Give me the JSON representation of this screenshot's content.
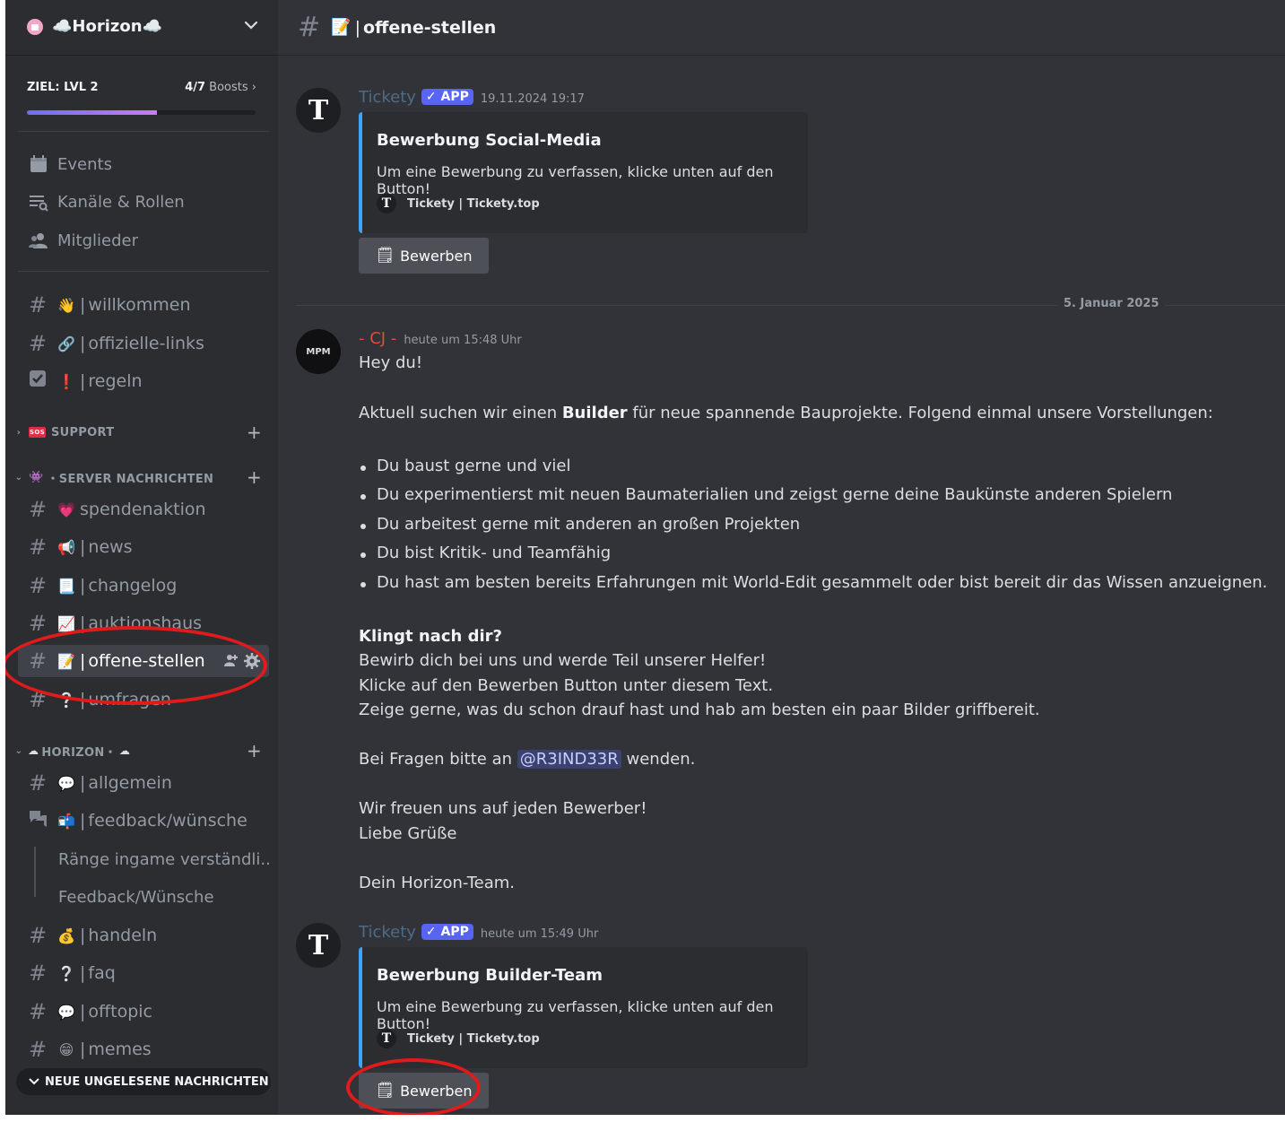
{
  "server": {
    "name": "☁️Horizon☁️",
    "boost_goal": "ZIEL: LVL 2",
    "boost_count_strong": "4/7",
    "boost_count_label": " Boosts",
    "boost_progress": 0.57
  },
  "nav": [
    {
      "label": "Events",
      "icon": "calendar-icon"
    },
    {
      "label": "Kanäle & Rollen",
      "icon": "channel-browse-icon"
    },
    {
      "label": "Mitglieder",
      "icon": "members-icon"
    }
  ],
  "channels_top": [
    {
      "emoji": "👋",
      "name": "willkommen"
    },
    {
      "emoji": "🔗",
      "name": "offizielle-links"
    },
    {
      "emoji": "❗",
      "name": "regeln"
    }
  ],
  "categories": {
    "support": "SUPPORT",
    "server_news": "・SERVER NACHRICHTEN",
    "horizon": "HORIZON・"
  },
  "channels_news": [
    {
      "emoji": "💗",
      "name": "spendenaktion"
    },
    {
      "emoji": "📢",
      "name": "news"
    },
    {
      "emoji": "📃",
      "name": "changelog"
    },
    {
      "emoji": "📈",
      "name": "auktionshaus"
    },
    {
      "emoji": "📝",
      "name": "offene-stellen"
    },
    {
      "emoji": "❔",
      "name": "umfragen"
    }
  ],
  "channels_horizon": [
    {
      "emoji": "💬",
      "name": "allgemein"
    },
    {
      "emoji": "📬",
      "name": "feedback/wünsche"
    }
  ],
  "threads": [
    "Ränge ingame verständli...",
    "Feedback/Wünsche"
  ],
  "channels_horizon2": [
    {
      "emoji": "💰",
      "name": "handeln"
    },
    {
      "emoji": "❔",
      "name": "faq"
    },
    {
      "emoji": "💬",
      "name": "offtopic"
    },
    {
      "emoji": "😁",
      "name": "memes"
    }
  ],
  "unread_pill": "NEUE UNGELESENE NACHRICHTEN",
  "channel_header": {
    "emoji": "📝",
    "name": "offene-stellen"
  },
  "messages": {
    "m1": {
      "author": "Tickety",
      "badge": "✓ APP",
      "timestamp": "19.11.2024 19:17",
      "embed_title": "Bewerbung Social-Media",
      "embed_desc": "Um eine Bewerbung zu verfassen, klicke unten auf den Button!",
      "embed_footer": "Tickety | Tickety.top",
      "button": "Bewerben"
    },
    "date_divider": "5. Januar 2025",
    "m2": {
      "author": "- CJ -",
      "timestamp": "heute um 15:48 Uhr",
      "greeting": "Hey du!",
      "intro_a": "Aktuell suchen wir einen ",
      "intro_bold": "Builder",
      "intro_b": " für neue spannende Bauprojekte. Folgend einmal unsere Vorstellungen:",
      "bullets": [
        "Du baust gerne und viel",
        "Du experimentierst mit neuen Baumaterialien und zeigst gerne deine Baukünste anderen Spielern",
        "Du arbeitest gerne mit anderen an großen Projekten",
        "Du bist Kritik- und Teamfähig",
        "Du hast am besten bereits Erfahrungen mit World-Edit gesammelt oder bist bereit dir das Wissen anzueignen."
      ],
      "cta_heading": "Klingt nach dir?",
      "cta_1": "Bewirb dich bei uns und werde Teil unserer Helfer!",
      "cta_2": "Klicke auf den Bewerben Button unter diesem Text.",
      "cta_3": "Zeige gerne, was du schon drauf hast und hab am besten ein paar Bilder griffbereit.",
      "questions_a": "Bei Fragen bitte an ",
      "mention": "@R3IND33R",
      "questions_b": " wenden.",
      "closing_1": "Wir freuen uns auf jeden Bewerber!",
      "closing_2": "Liebe Grüße",
      "signature": "Dein Horizon-Team."
    },
    "m3": {
      "author": "Tickety",
      "badge": "✓ APP",
      "timestamp": "heute um 15:49 Uhr",
      "embed_title": "Bewerbung Builder-Team",
      "embed_desc": "Um eine Bewerbung zu verfassen, klicke unten auf den Button!",
      "embed_footer": "Tickety | Tickety.top",
      "button": "Bewerben"
    }
  },
  "colors": {
    "accent": "#5865f2",
    "embed_bar": "#3ba4ff",
    "annotation": "#e11b1b",
    "cj_name": "#e5493a",
    "bot_name": "#4e6b85"
  }
}
